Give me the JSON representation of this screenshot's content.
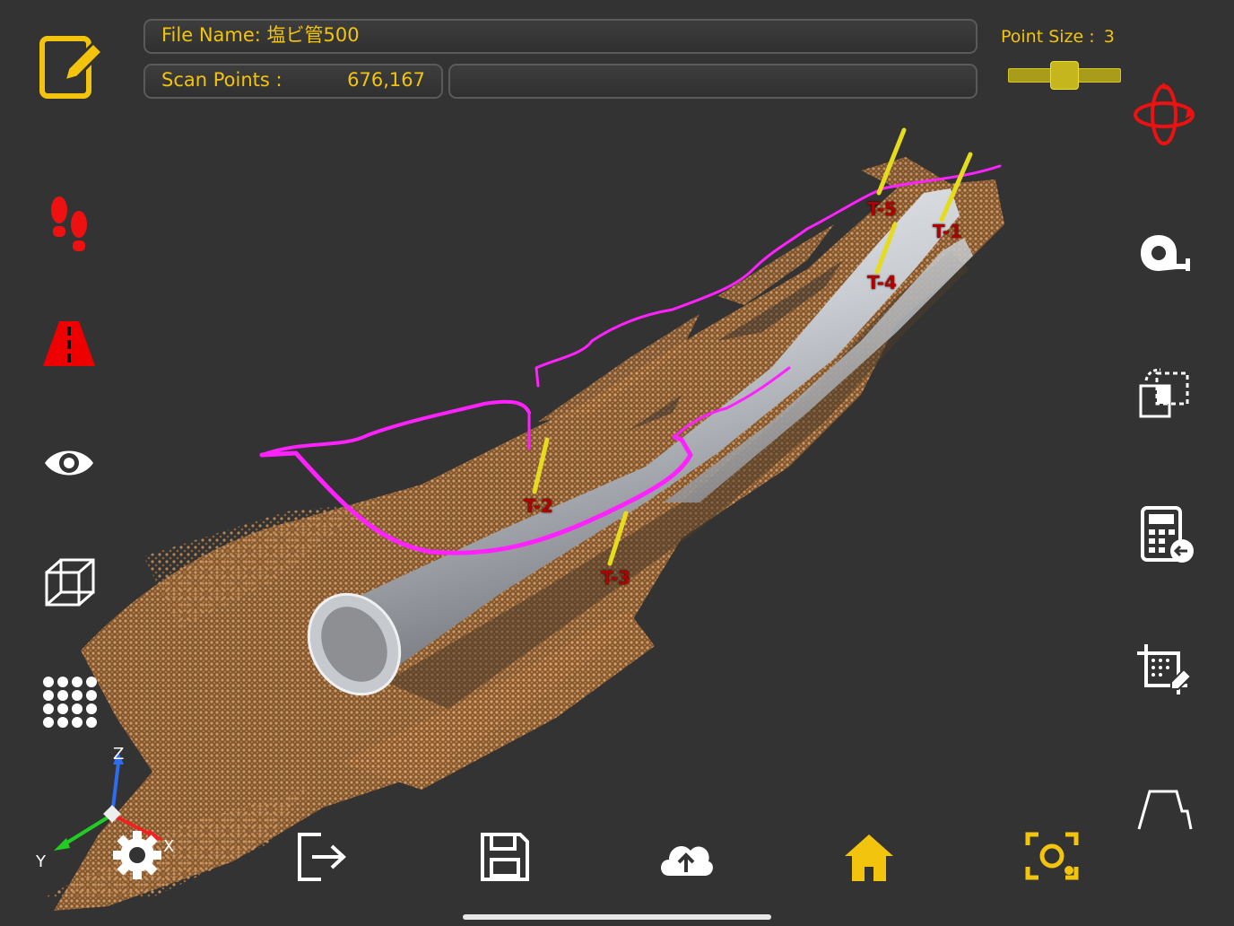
{
  "header": {
    "file_name_label": "File Name: 塩ビ管500",
    "scan_points_label": "Scan Points :",
    "scan_points_value": "676,167",
    "point_size_label": "Point Size :",
    "point_size_value": "3",
    "point_size_level": 0.5
  },
  "markers": {
    "t1": "T-1",
    "t2": "T-2",
    "t3": "T-3",
    "t4": "T-4",
    "t5": "T-5"
  },
  "axes": {
    "x": "X",
    "y": "Y",
    "z": "Z"
  },
  "colors": {
    "accent_yellow": "#f2c40d",
    "alert_red": "#ff0000",
    "trace_magenta": "#ff22ff",
    "background": "#333333"
  },
  "left_toolbar": [
    "edit-icon",
    "footsteps-icon",
    "road-icon",
    "eye-icon",
    "wireframe-cube-icon",
    "dot-grid-icon"
  ],
  "right_toolbar": [
    "orbit-icon",
    "tape-measure-icon",
    "select-copy-icon",
    "calculator-icon",
    "crop-area-icon",
    "profile-icon"
  ],
  "bottom_toolbar": [
    "settings-icon",
    "exit-icon",
    "save-icon",
    "cloud-upload-icon",
    "home-icon",
    "scan-camera-icon"
  ]
}
